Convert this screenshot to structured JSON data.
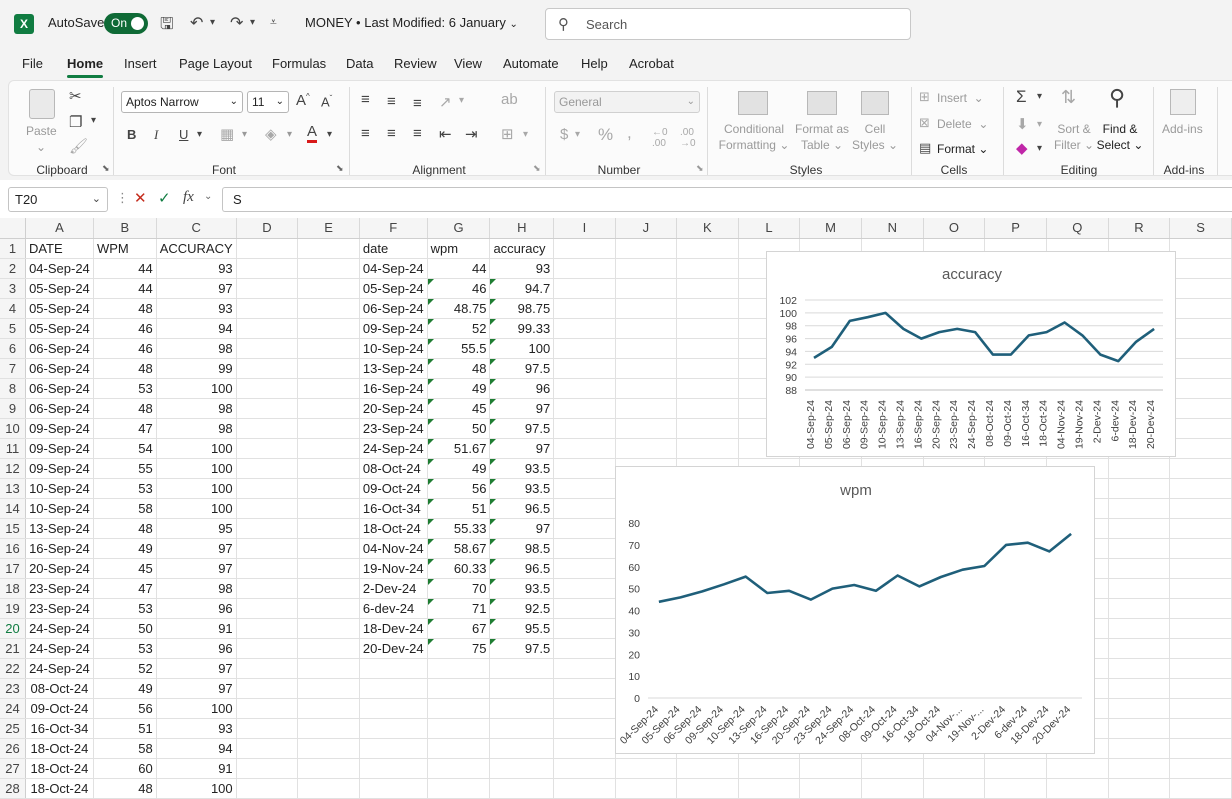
{
  "titlebar": {
    "autosave_label": "AutoSave",
    "autosave_state": "On",
    "doc_title": "MONEY • Last Modified: 6 January",
    "search_placeholder": "Search"
  },
  "menu": {
    "tabs": [
      "File",
      "Home",
      "Insert",
      "Page Layout",
      "Formulas",
      "Data",
      "Review",
      "View",
      "Automate",
      "Help",
      "Acrobat"
    ],
    "active": "Home"
  },
  "ribbon": {
    "clipboard": {
      "label": "Clipboard",
      "paste": "Paste"
    },
    "font": {
      "label": "Font",
      "font_name": "Aptos Narrow",
      "font_size": "11"
    },
    "alignment": {
      "label": "Alignment"
    },
    "number": {
      "label": "Number",
      "format": "General"
    },
    "styles": {
      "label": "Styles",
      "conditional_1": "Conditional",
      "conditional_2": "Formatting",
      "format_table_1": "Format as",
      "format_table_2": "Table",
      "cell_styles_1": "Cell",
      "cell_styles_2": "Styles"
    },
    "cells": {
      "label": "Cells",
      "insert": "Insert",
      "delete": "Delete",
      "format": "Format"
    },
    "editing": {
      "label": "Editing",
      "sort_1": "Sort &",
      "sort_2": "Filter",
      "find_1": "Find &",
      "find_2": "Select"
    },
    "addins": {
      "label": "Add-ins",
      "addins_btn": "Add-ins"
    }
  },
  "formula_bar": {
    "name_box": "T20",
    "value": "S"
  },
  "columns": [
    "A",
    "B",
    "C",
    "D",
    "E",
    "F",
    "G",
    "H",
    "I",
    "J",
    "K",
    "L",
    "M",
    "N",
    "O",
    "P",
    "Q",
    "R",
    "S"
  ],
  "rows": [
    {
      "n": "1",
      "A": "DATE",
      "B": "WPM",
      "C": "ACCURACY",
      "F": "date",
      "G": "wpm",
      "H": "accuracy"
    },
    {
      "n": "2",
      "A": "04-Sep-24",
      "B": "44",
      "C": "93",
      "F": "04-Sep-24",
      "G": "44",
      "H": "93"
    },
    {
      "n": "3",
      "A": "05-Sep-24",
      "B": "44",
      "C": "97",
      "F": "05-Sep-24",
      "G": "46",
      "H": "94.7"
    },
    {
      "n": "4",
      "A": "05-Sep-24",
      "B": "48",
      "C": "93",
      "F": "06-Sep-24",
      "G": "48.75",
      "H": "98.75"
    },
    {
      "n": "5",
      "A": "05-Sep-24",
      "B": "46",
      "C": "94",
      "F": "09-Sep-24",
      "G": "52",
      "H": "99.33"
    },
    {
      "n": "6",
      "A": "06-Sep-24",
      "B": "46",
      "C": "98",
      "F": "10-Sep-24",
      "G": "55.5",
      "H": "100"
    },
    {
      "n": "7",
      "A": "06-Sep-24",
      "B": "48",
      "C": "99",
      "F": "13-Sep-24",
      "G": "48",
      "H": "97.5"
    },
    {
      "n": "8",
      "A": "06-Sep-24",
      "B": "53",
      "C": "100",
      "F": "16-Sep-24",
      "G": "49",
      "H": "96"
    },
    {
      "n": "9",
      "A": "06-Sep-24",
      "B": "48",
      "C": "98",
      "F": "20-Sep-24",
      "G": "45",
      "H": "97"
    },
    {
      "n": "10",
      "A": "09-Sep-24",
      "B": "47",
      "C": "98",
      "F": "23-Sep-24",
      "G": "50",
      "H": "97.5"
    },
    {
      "n": "11",
      "A": "09-Sep-24",
      "B": "54",
      "C": "100",
      "F": "24-Sep-24",
      "G": "51.67",
      "H": "97"
    },
    {
      "n": "12",
      "A": "09-Sep-24",
      "B": "55",
      "C": "100",
      "F": "08-Oct-24",
      "G": "49",
      "H": "93.5"
    },
    {
      "n": "13",
      "A": "10-Sep-24",
      "B": "53",
      "C": "100",
      "F": "09-Oct-24",
      "G": "56",
      "H": "93.5"
    },
    {
      "n": "14",
      "A": "10-Sep-24",
      "B": "58",
      "C": "100",
      "F": "16-Oct-34",
      "G": "51",
      "H": "96.5"
    },
    {
      "n": "15",
      "A": "13-Sep-24",
      "B": "48",
      "C": "95",
      "F": "18-Oct-24",
      "G": "55.33",
      "H": "97"
    },
    {
      "n": "16",
      "A": "16-Sep-24",
      "B": "49",
      "C": "97",
      "F": "04-Nov-24",
      "G": "58.67",
      "H": "98.5"
    },
    {
      "n": "17",
      "A": "20-Sep-24",
      "B": "45",
      "C": "97",
      "F": "19-Nov-24",
      "G": "60.33",
      "H": "96.5"
    },
    {
      "n": "18",
      "A": "23-Sep-24",
      "B": "47",
      "C": "98",
      "F": "2-Dev-24",
      "G": "70",
      "H": "93.5"
    },
    {
      "n": "19",
      "A": "23-Sep-24",
      "B": "53",
      "C": "96",
      "F": "6-dev-24",
      "G": "71",
      "H": "92.5"
    },
    {
      "n": "20",
      "A": "24-Sep-24",
      "B": "50",
      "C": "91",
      "F": "18-Dev-24",
      "G": "67",
      "H": "95.5"
    },
    {
      "n": "21",
      "A": "24-Sep-24",
      "B": "53",
      "C": "96",
      "F": "20-Dev-24",
      "G": "75",
      "H": "97.5"
    },
    {
      "n": "22",
      "A": "24-Sep-24",
      "B": "52",
      "C": "97"
    },
    {
      "n": "23",
      "A": "08-Oct-24",
      "B": "49",
      "C": "97"
    },
    {
      "n": "24",
      "A": "09-Oct-24",
      "B": "56",
      "C": "100"
    },
    {
      "n": "25",
      "A": "16-Oct-34",
      "B": "51",
      "C": "93"
    },
    {
      "n": "26",
      "A": "18-Oct-24",
      "B": "58",
      "C": "94"
    },
    {
      "n": "27",
      "A": "18-Oct-24",
      "B": "60",
      "C": "91"
    },
    {
      "n": "28",
      "A": "18-Oct-24",
      "B": "48",
      "C": "100"
    }
  ],
  "selected_row": "20",
  "colors": {
    "accent": "#107c41",
    "series_line": "#1f5f7a"
  },
  "chart_data": [
    {
      "type": "line",
      "title": "accuracy",
      "categories": [
        "04-Sep-24",
        "05-Sep-24",
        "06-Sep-24",
        "09-Sep-24",
        "10-Sep-24",
        "13-Sep-24",
        "16-Sep-24",
        "20-Sep-24",
        "23-Sep-24",
        "24-Sep-24",
        "08-Oct-24",
        "09-Oct-24",
        "16-Oct-34",
        "18-Oct-24",
        "04-Nov-24",
        "19-Nov-24",
        "2-Dev-24",
        "6-dev-24",
        "18-Dev-24",
        "20-Dev-24"
      ],
      "values": [
        93,
        94.7,
        98.75,
        99.33,
        100,
        97.5,
        96,
        97,
        97.5,
        97,
        93.5,
        93.5,
        96.5,
        97,
        98.5,
        96.5,
        93.5,
        92.5,
        95.5,
        97.5
      ],
      "ylim": [
        88,
        102
      ],
      "yticks": [
        88,
        90,
        92,
        94,
        96,
        98,
        100,
        102
      ],
      "grid": true,
      "legend": "none"
    },
    {
      "type": "line",
      "title": "wpm",
      "categories": [
        "04-Sep-24",
        "05-Sep-24",
        "06-Sep-24",
        "09-Sep-24",
        "10-Sep-24",
        "13-Sep-24",
        "16-Sep-24",
        "20-Sep-24",
        "23-Sep-24",
        "24-Sep-24",
        "08-Oct-24",
        "09-Oct-24",
        "16-Oct-34",
        "18-Oct-24",
        "04-Nov-...",
        "19-Nov-...",
        "2-Dev-24",
        "6-dev-24",
        "18-Dev-24",
        "20-Dev-24"
      ],
      "values": [
        44,
        46,
        48.75,
        52,
        55.5,
        48,
        49,
        45,
        50,
        51.67,
        49,
        56,
        51,
        55.33,
        58.67,
        60.33,
        70,
        71,
        67,
        75
      ],
      "ylim": [
        0,
        80
      ],
      "yticks": [
        0,
        10,
        20,
        30,
        40,
        50,
        60,
        70,
        80
      ],
      "grid": false,
      "legend": "none"
    }
  ]
}
